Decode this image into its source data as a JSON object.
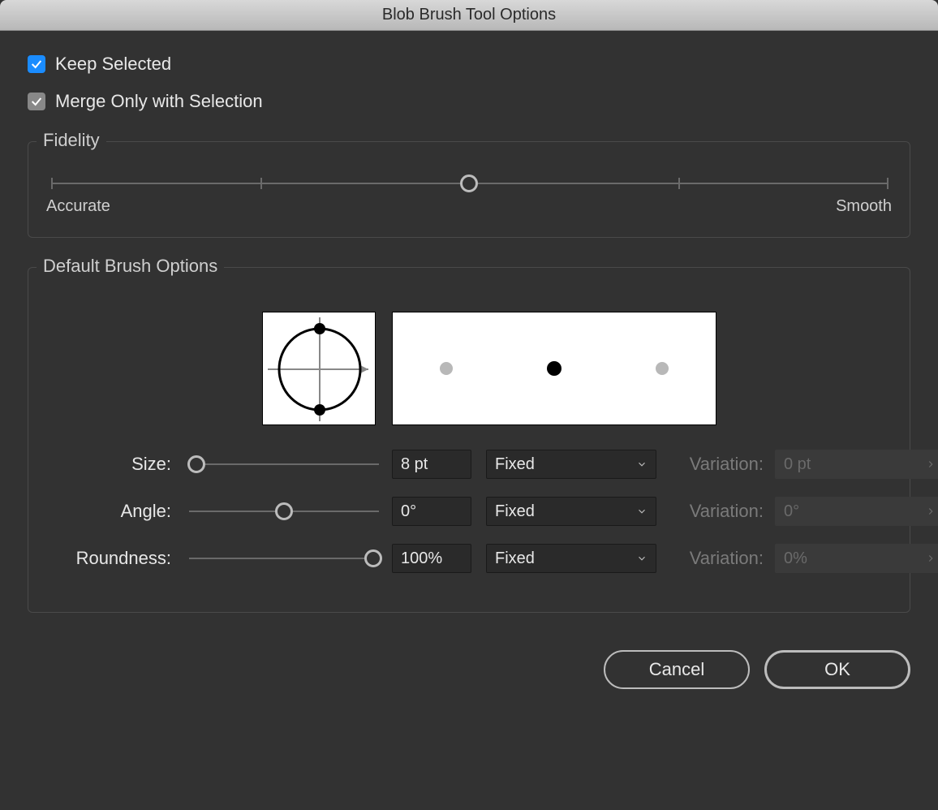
{
  "title": "Blob Brush Tool Options",
  "checkboxes": {
    "keep_selected": {
      "label": "Keep Selected",
      "checked": true
    },
    "merge_only": {
      "label": "Merge Only with Selection",
      "checked": true
    }
  },
  "fidelity": {
    "title": "Fidelity",
    "left_label": "Accurate",
    "right_label": "Smooth",
    "value_percent": 50
  },
  "brush": {
    "title": "Default Brush Options",
    "rows": {
      "size": {
        "label": "Size:",
        "slider_percent": 4,
        "value": "8 pt",
        "mode": "Fixed",
        "variation_label": "Variation:",
        "variation_value": "0 pt",
        "variation_enabled": false
      },
      "angle": {
        "label": "Angle:",
        "slider_percent": 50,
        "value": "0°",
        "mode": "Fixed",
        "variation_label": "Variation:",
        "variation_value": "0°",
        "variation_enabled": false
      },
      "roundness": {
        "label": "Roundness:",
        "slider_percent": 97,
        "value": "100%",
        "mode": "Fixed",
        "variation_label": "Variation:",
        "variation_value": "0%",
        "variation_enabled": false
      }
    }
  },
  "footer": {
    "cancel": "Cancel",
    "ok": "OK"
  }
}
